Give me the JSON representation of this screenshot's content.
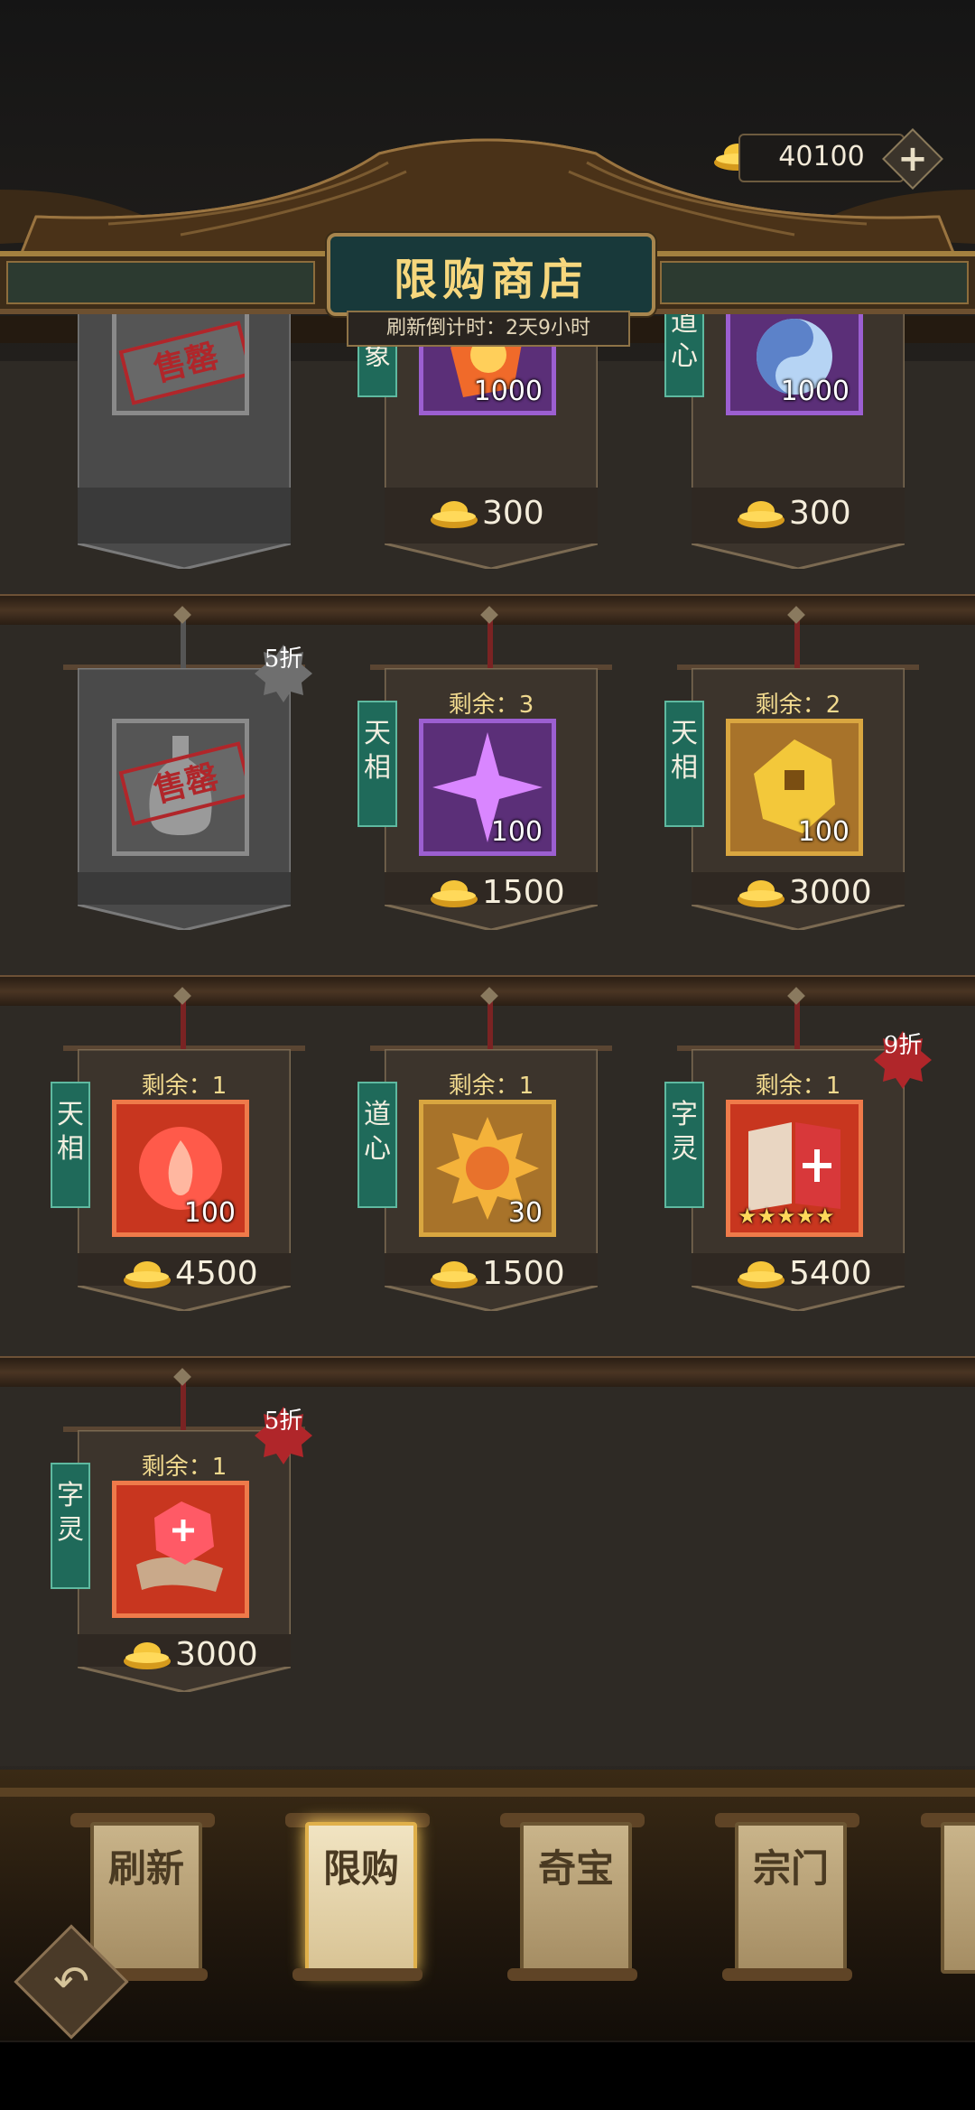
{
  "header": {
    "title": "限购商店",
    "refresh_countdown": "刷新倒计时：2天9小时",
    "currency": {
      "icon": "gold-ingot-icon",
      "amount": "40100",
      "add_icon": "plus-icon"
    }
  },
  "shop_items": [
    {
      "status": "sold_out",
      "stamp": "售罄",
      "icon": "vase-icon"
    },
    {
      "tag": "法象",
      "icon": "fire-gem-icon",
      "qty": "1000",
      "price": "300"
    },
    {
      "tag": "道心",
      "icon": "yin-yang-fish-icon",
      "qty": "1000",
      "price": "300"
    },
    {
      "status": "sold_out",
      "stamp": "售罄",
      "icon": "vase-icon",
      "discount": "5折"
    },
    {
      "tag": "天相",
      "icon": "purple-star-icon",
      "remaining": "剩余：3",
      "qty": "100",
      "price": "1500"
    },
    {
      "tag": "天相",
      "icon": "gold-coin-icon",
      "remaining": "剩余：2",
      "qty": "100",
      "price": "3000"
    },
    {
      "tag": "天相",
      "icon": "flame-orb-icon",
      "remaining": "剩余：1",
      "qty": "100",
      "price": "4500"
    },
    {
      "tag": "道心",
      "icon": "sun-emblem-icon",
      "remaining": "剩余：1",
      "qty": "30",
      "price": "1500"
    },
    {
      "tag": "字灵",
      "icon": "book-icon",
      "remaining": "剩余：1",
      "stars": 5,
      "price": "5400",
      "discount": "9折"
    },
    {
      "tag": "字灵",
      "icon": "red-gem-scroll-icon",
      "remaining": "剩余：1",
      "price": "3000",
      "discount": "5折"
    }
  ],
  "nav": {
    "tabs": [
      {
        "label": "刷新"
      },
      {
        "label": "限购",
        "active": true
      },
      {
        "label": "奇宝"
      },
      {
        "label": "宗门"
      }
    ],
    "back_icon": "back-arrow-icon"
  },
  "colors": {
    "gold_text": "#f6d77d",
    "tag_green": "#1f6a5a",
    "discount_red": "#b0262a"
  }
}
